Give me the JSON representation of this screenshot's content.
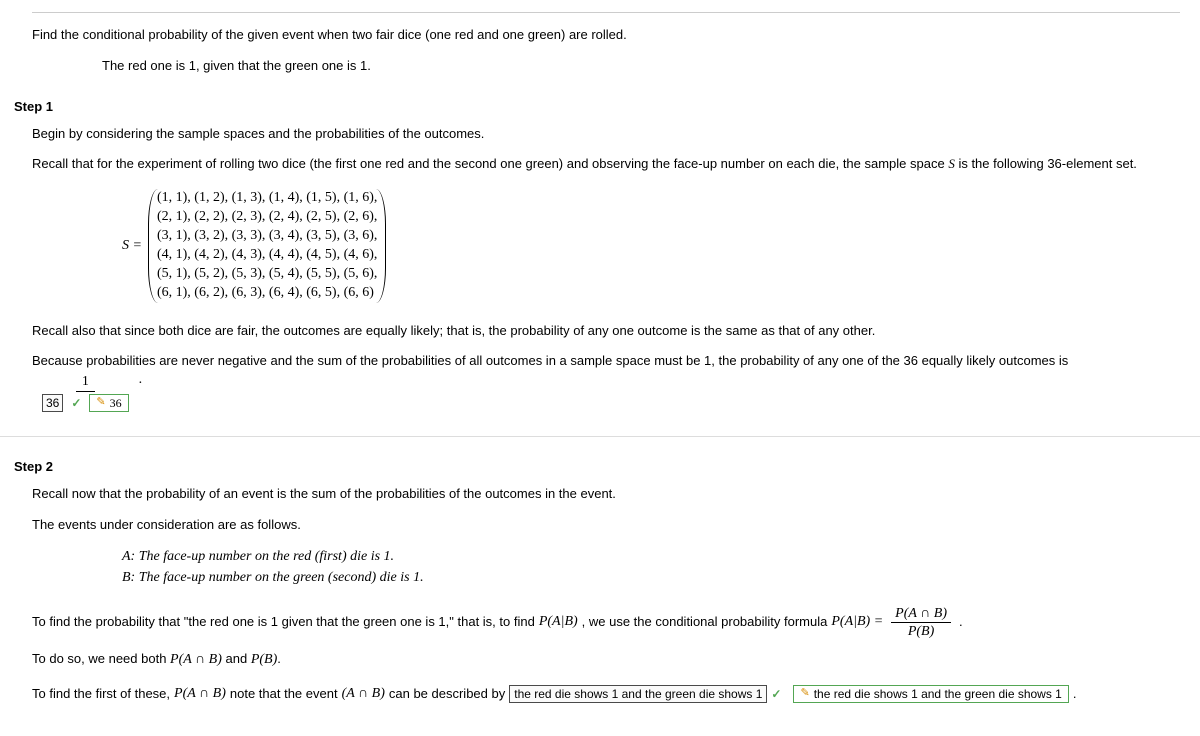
{
  "question": {
    "main": "Find the conditional probability of the given event when two fair dice (one red and one green) are rolled.",
    "sub": "The red one is 1, given that the green one is 1."
  },
  "step1": {
    "label": "Step 1",
    "p1": "Begin by considering the sample spaces and the probabilities of the outcomes.",
    "p2_a": "Recall that for the experiment of rolling two dice (the first one red and the second one green) and observing the face-up number on each die, the sample space ",
    "p2_s": "S",
    "p2_b": " is the following 36-element set.",
    "set_label": "S = ",
    "set_rows": [
      "(1, 1), (1, 2), (1, 3), (1, 4), (1, 5), (1, 6),",
      "(2, 1), (2, 2), (2, 3), (2, 4), (2, 5), (2, 6),",
      "(3, 1), (3, 2), (3, 3), (3, 4), (3, 5), (3, 6),",
      "(4, 1), (4, 2), (4, 3), (4, 4), (4, 5), (4, 6),",
      "(5, 1), (5, 2), (5, 3), (5, 4), (5, 5), (5, 6),",
      "(6, 1), (6, 2), (6, 3), (6, 4), (6, 5), (6, 6)"
    ],
    "p3": "Recall also that since both dice are fair, the outcomes are equally likely; that is, the probability of any one outcome is the same as that of any other.",
    "p4": "Because probabilities are never negative and the sum of the probabilities of all outcomes in a sample space must be 1, the probability of any one of the 36 equally likely outcomes is",
    "frac_num": "1",
    "dot": ".",
    "user_answer": "36",
    "correct_answer": "36"
  },
  "step2": {
    "label": "Step 2",
    "p1": "Recall now that the probability of an event is the sum of the probabilities of the outcomes in the event.",
    "p2": "The events under consideration are as follows.",
    "event_a": "A: The face-up number on the red (first) die is 1.",
    "event_b": "B: The face-up number on the green (second) die is 1.",
    "p3_a": "To find the probability that \"the red one is 1 given that the green one is 1,\" that is, to find ",
    "p3_pab": "P(A|B)",
    "p3_b": ", we use the conditional probability formula ",
    "p3_formula_lhs": "P(A|B) = ",
    "p3_frac_num": "P(A ∩ B)",
    "p3_frac_den": "P(B)",
    "p3_c": ".",
    "p4_a": "To do so, we need both ",
    "p4_b": "P(A ∩ B)",
    "p4_c": " and ",
    "p4_d": "P(B)",
    "p4_e": ".",
    "p5_a": "To find the first of these, ",
    "p5_b": "P(A ∩ B)",
    "p5_c": " note that the event ",
    "p5_d": "(A ∩ B)",
    "p5_e": " can be described by ",
    "user_select": "the red die shows 1 and the green die shows 1",
    "correct_select": "the red die shows 1 and the green die shows 1",
    "p5_f": " ."
  }
}
